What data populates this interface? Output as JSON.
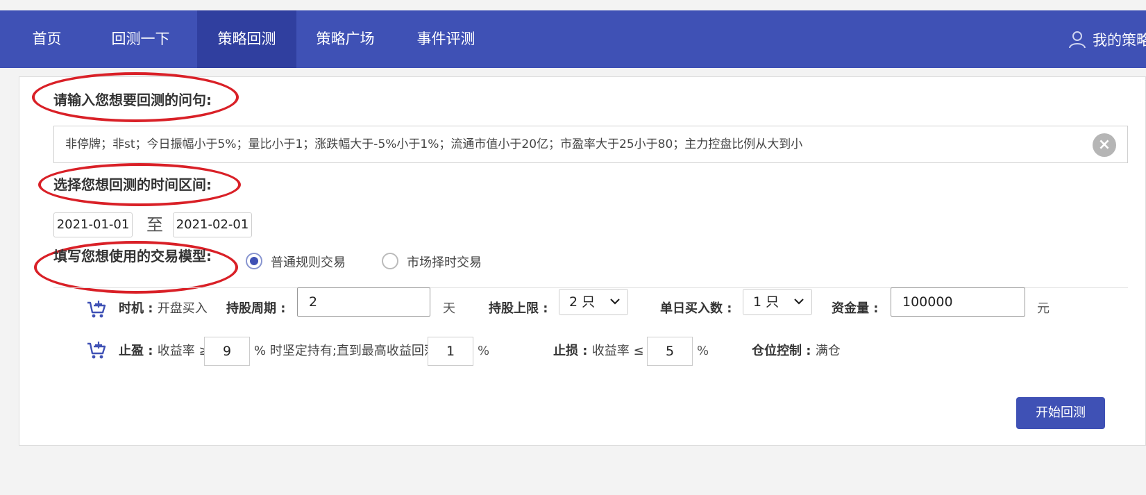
{
  "nav": {
    "items": [
      {
        "label": "首页"
      },
      {
        "label": "回测一下"
      },
      {
        "label": "策略回测"
      },
      {
        "label": "策略广场"
      },
      {
        "label": "事件评测"
      }
    ],
    "active_index": 2,
    "user_label": "我的策略",
    "colors": {
      "bar": "#3f51b5",
      "active": "#303f9f"
    }
  },
  "query": {
    "heading": "请输入您想要回测的问句:",
    "value": "非停牌；非st；今日振幅小于5%；量比小于1；涨跌幅大于-5%小于1%；流通市值小于20亿；市盈率大于25小于80；主力控盘比例从大到小",
    "clear_icon": "×"
  },
  "period": {
    "heading": "选择您想回测的时间区间:",
    "start": "2021-01-01",
    "to_label": "至",
    "end": "2021-02-01"
  },
  "model": {
    "heading": "填写您想使用的交易模型:",
    "options": [
      {
        "label": "普通规则交易",
        "checked": true
      },
      {
        "label": "市场择时交易",
        "checked": false
      }
    ]
  },
  "buy": {
    "timing_label": "时机",
    "timing_value": "开盘买入",
    "hold_period_label": "持股周期",
    "hold_period_value": "2",
    "hold_period_unit": "天",
    "hold_limit_label": "持股上限",
    "hold_limit_value": "2 只",
    "daily_buy_label": "单日买入数",
    "daily_buy_value": "1 只",
    "capital_label": "资金量",
    "capital_value": "100000",
    "capital_unit": "元"
  },
  "sell": {
    "take_profit_label": "止盈",
    "take_profit_prefix": "收益率 ≥",
    "take_profit_value": "9",
    "take_profit_mid": "% 时坚定持有;直到最高收益回落",
    "drawdown_value": "1",
    "drawdown_unit": "%",
    "stop_loss_label": "止损",
    "stop_loss_prefix": "收益率 ≤ -",
    "stop_loss_value": "5",
    "stop_loss_unit": "%",
    "position_label": "仓位控制",
    "position_value": "满仓"
  },
  "actions": {
    "start_label": "开始回测"
  },
  "annotation_color": "#d92027"
}
